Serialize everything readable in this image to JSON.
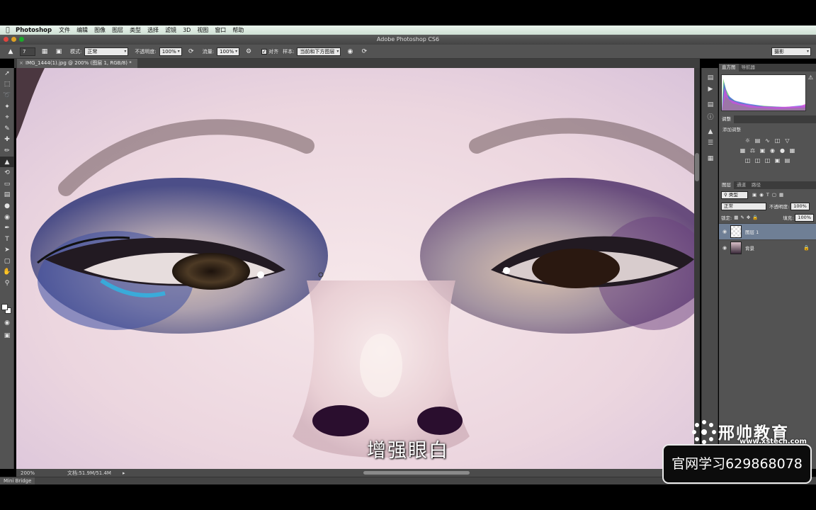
{
  "menubar": {
    "app_name": "Photoshop",
    "items": [
      "文件",
      "编辑",
      "图像",
      "图层",
      "类型",
      "选择",
      "滤镜",
      "3D",
      "视图",
      "窗口",
      "帮助"
    ]
  },
  "window": {
    "title": "Adobe Photoshop CS6"
  },
  "options_bar": {
    "brush_size": "7",
    "mode_label": "模式:",
    "mode_value": "正常",
    "opacity_label": "不透明度:",
    "opacity_value": "100%",
    "flow_label": "流量:",
    "flow_value": "100%",
    "aligned_label": "对齐",
    "sample_label": "样本:",
    "sample_value": "当前和下方图层",
    "workspace_value": "摄影"
  },
  "document": {
    "tab_title": "IMG_1444(1).jpg @ 200% (图层 1, RGB/8) *",
    "zoom": "200%",
    "doc_size": "文档:51.9M/51.4M"
  },
  "bottom_bar": {
    "mini_bridge": "Mini Bridge"
  },
  "panels": {
    "histogram_tabs": [
      "直方图",
      "导航器"
    ],
    "adjustments_tab": "调整",
    "adjustments_title": "添加调整",
    "layers_tabs": [
      "图层",
      "通道",
      "路径"
    ],
    "filter_kind": "类型",
    "blend_mode": "正常",
    "opacity_label": "不透明度:",
    "opacity_value": "100%",
    "lock_label": "锁定:",
    "fill_label": "填充:",
    "fill_value": "100%",
    "layers": [
      {
        "name": "图层 1",
        "active": true
      },
      {
        "name": "背景",
        "active": false,
        "locked": true
      }
    ]
  },
  "overlay": {
    "subtitle": "增强眼白",
    "brand_name": "邢帅教育",
    "brand_url": "www.xstech.com",
    "promo": "官网学习629868078"
  },
  "colors": {
    "ui_dark": "#535353",
    "menubar_bg": "#d9e9dd",
    "layer_selected": "#6f7f95",
    "skin": "#f1dde2"
  }
}
